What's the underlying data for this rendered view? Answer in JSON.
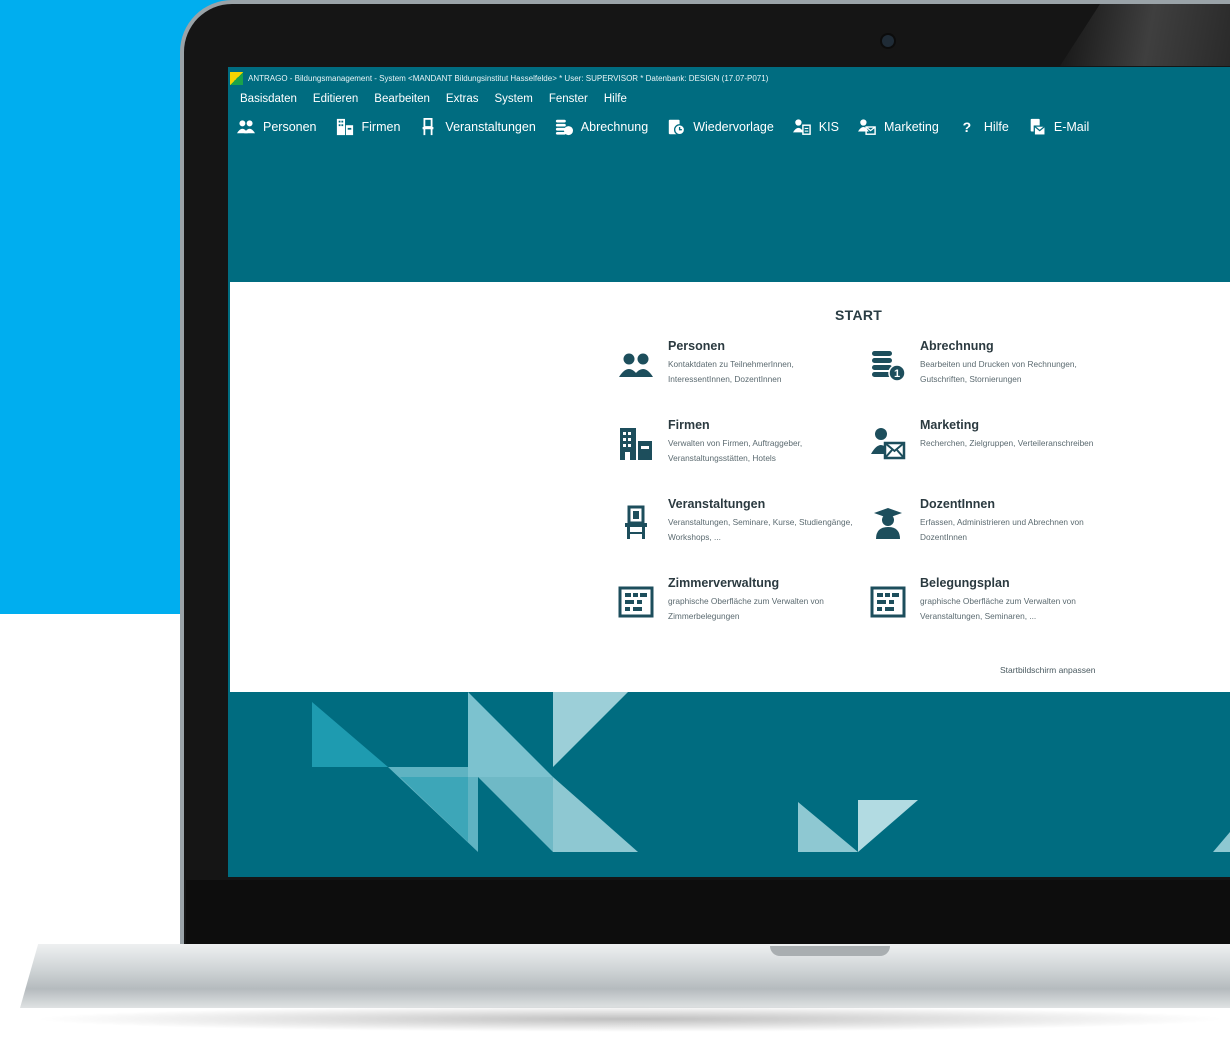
{
  "window": {
    "title": "ANTRAGO - Bildungsmanagement - System <MANDANT Bildungsinstitut Hasselfelde> * User: SUPERVISOR * Datenbank: DESIGN (17.07-P071)"
  },
  "menubar": {
    "items": [
      "Basisdaten",
      "Editieren",
      "Bearbeiten",
      "Extras",
      "System",
      "Fenster",
      "Hilfe"
    ]
  },
  "toolbar": {
    "items": [
      {
        "label": "Personen",
        "icon": "people-icon"
      },
      {
        "label": "Firmen",
        "icon": "building-icon"
      },
      {
        "label": "Veranstaltungen",
        "icon": "chair-icon"
      },
      {
        "label": "Abrechnung",
        "icon": "coins-icon"
      },
      {
        "label": "Wiedervorlage",
        "icon": "reminder-icon"
      },
      {
        "label": "KIS",
        "icon": "kis-icon"
      },
      {
        "label": "Marketing",
        "icon": "marketing-icon"
      },
      {
        "label": "Hilfe",
        "icon": "question-icon"
      },
      {
        "label": "E-Mail",
        "icon": "email-icon"
      }
    ]
  },
  "start": {
    "title": "START",
    "tiles": [
      {
        "title": "Personen",
        "desc": "Kontaktdaten zu TeilnehmerInnen, InteressentInnen, DozentInnen",
        "icon": "people-icon"
      },
      {
        "title": "Abrechnung",
        "desc": "Bearbeiten und Drucken von Rechnungen, Gutschriften, Stornierungen",
        "icon": "coins-icon"
      },
      {
        "title": "Firmen",
        "desc": "Verwalten von Firmen, Auftraggeber, Veranstaltungsstätten, Hotels",
        "icon": "building-icon"
      },
      {
        "title": "Marketing",
        "desc": "Recherchen, Zielgruppen, Verteileranschreiben",
        "icon": "marketing-icon"
      },
      {
        "title": "Veranstaltungen",
        "desc": "Veranstaltungen, Seminare, Kurse, Studiengänge, Workshops, ...",
        "icon": "chair-icon"
      },
      {
        "title": "DozentInnen",
        "desc": "Erfassen, Administrieren und Abrechnen von DozentInnen",
        "icon": "teacher-icon"
      },
      {
        "title": "Zimmerverwaltung",
        "desc": "graphische Oberfläche zum Verwalten von Zimmerbelegungen",
        "icon": "grid-plan-icon"
      },
      {
        "title": "Belegungsplan",
        "desc": "graphische Oberfläche zum Verwalten von Veranstaltungen, Seminaren, ...",
        "icon": "grid-plan-icon"
      }
    ],
    "customize_link": "Startbildschirm anpassen"
  },
  "colors": {
    "background_blue": "#00aeef",
    "app_teal": "#006c80",
    "icon_dark": "#1d4e5c",
    "panel_white": "#ffffff"
  }
}
